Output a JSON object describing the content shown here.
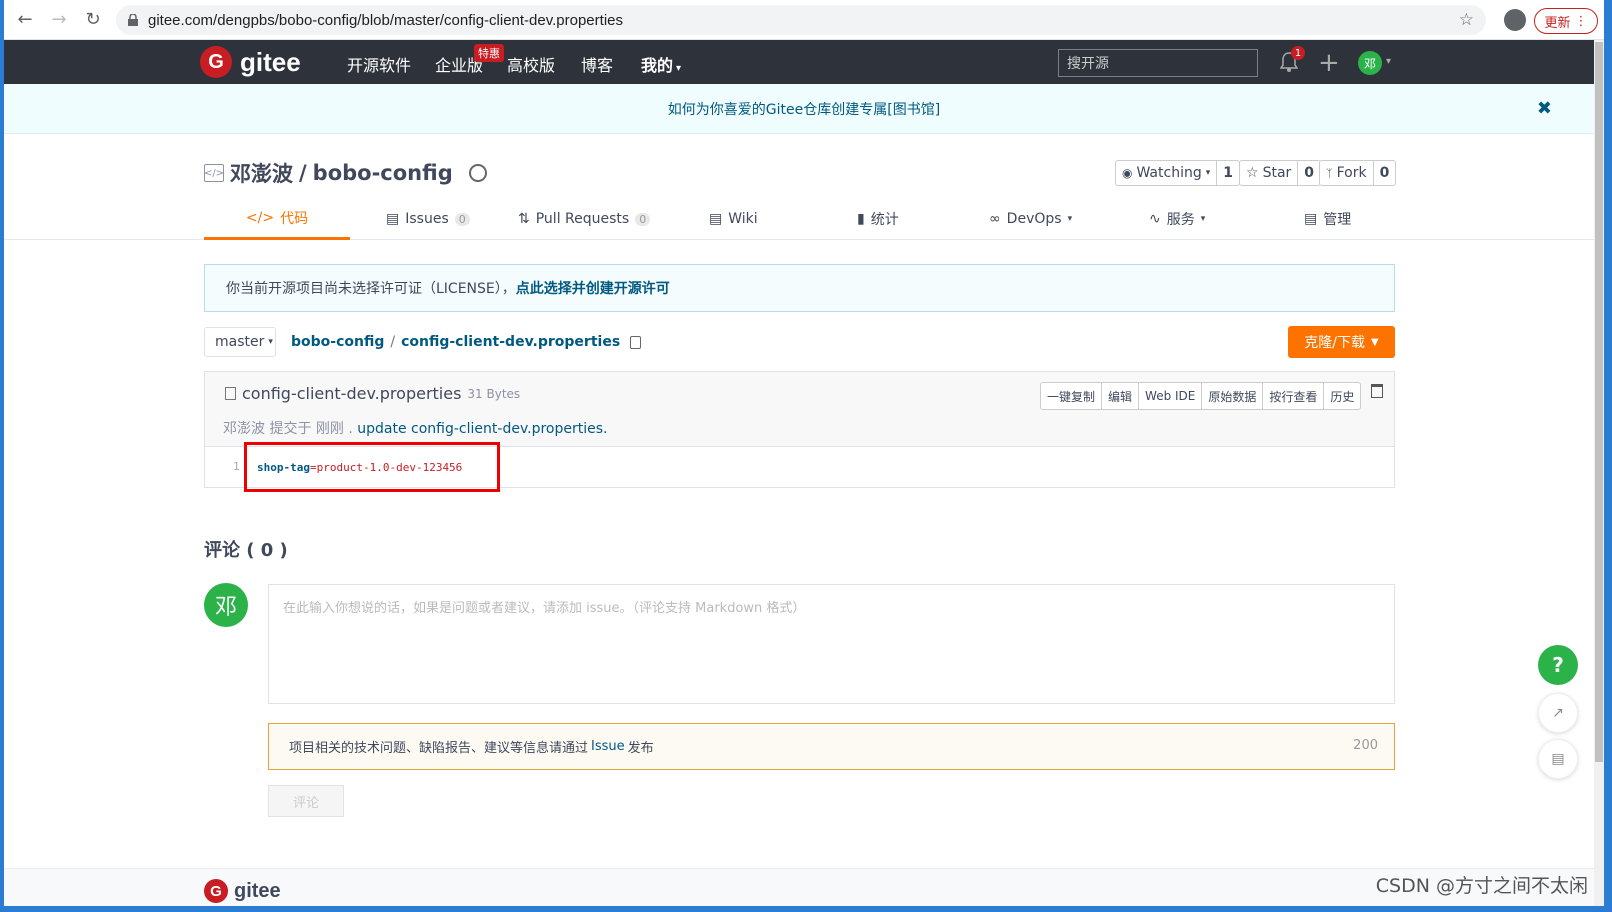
{
  "browser": {
    "url": "gitee.com/dengpbs/bobo-config/blob/master/config-client-dev.properties",
    "update_label": "更新"
  },
  "header": {
    "logo_text": "gitee",
    "logo_letter": "G",
    "nav": [
      "开源软件",
      "企业版",
      "高校版",
      "博客",
      "我的"
    ],
    "enterprise_badge": "特惠",
    "search_placeholder": "搜开源",
    "notification_count": "1",
    "avatar_letter": "邓"
  },
  "notice": {
    "text": "如何为你喜爱的Gitee仓库创建专属[图书馆]",
    "close": "✖"
  },
  "repo": {
    "owner": "邓澎波",
    "separator": "/",
    "name": "bobo-config",
    "watching_label": "Watching",
    "watching_count": "1",
    "star_label": "Star",
    "star_count": "0",
    "fork_label": "Fork",
    "fork_count": "0"
  },
  "tabs": {
    "code": "代码",
    "issues": "Issues",
    "issues_count": "0",
    "pulls": "Pull Requests",
    "pulls_count": "0",
    "wiki": "Wiki",
    "stats": "统计",
    "devops": "DevOps",
    "services": "服务",
    "manage": "管理"
  },
  "license_notice": {
    "text": "你当前开源项目尚未选择许可证（LICENSE），",
    "link": "点此选择并创建开源许可"
  },
  "breadcrumb": {
    "branch": "master",
    "repo": "bobo-config",
    "separator": "/",
    "file": "config-client-dev.properties",
    "clone_label": "克隆/下载"
  },
  "file": {
    "name": "config-client-dev.properties",
    "size": "31 Bytes",
    "commit_prefix": "邓澎波 提交于 刚刚 .",
    "commit_message": "update config-client-dev.properties.",
    "actions": [
      "一键复制",
      "编辑",
      "Web IDE",
      "原始数据",
      "按行查看",
      "历史"
    ],
    "lines": [
      {
        "no": "1",
        "key": "shop-tag",
        "eq": "=",
        "value": "product-1.0-dev-123456"
      }
    ]
  },
  "comments": {
    "title": "评论 ( 0 )",
    "avatar_letter": "邓",
    "placeholder": "在此输入你想说的话，如果是问题或者建议，请添加 issue。（评论支持 Markdown 格式）",
    "notice_prefix": "项目相关的技术问题、缺陷报告、建议等信息请通过",
    "notice_link": "Issue",
    "notice_suffix": "发布",
    "char_count": "200",
    "submit_label": "评论"
  },
  "footer": {
    "logo_text": "gitee",
    "logo_letter": "G",
    "watermark": "CSDN @方寸之间不太闲"
  },
  "floating": {
    "help": "?"
  },
  "colors": {
    "brand_red": "#c71d23",
    "header_bg": "#2e323b",
    "accent_orange": "#fe7300",
    "link_blue": "#005980",
    "highlight_red": "#e00"
  }
}
